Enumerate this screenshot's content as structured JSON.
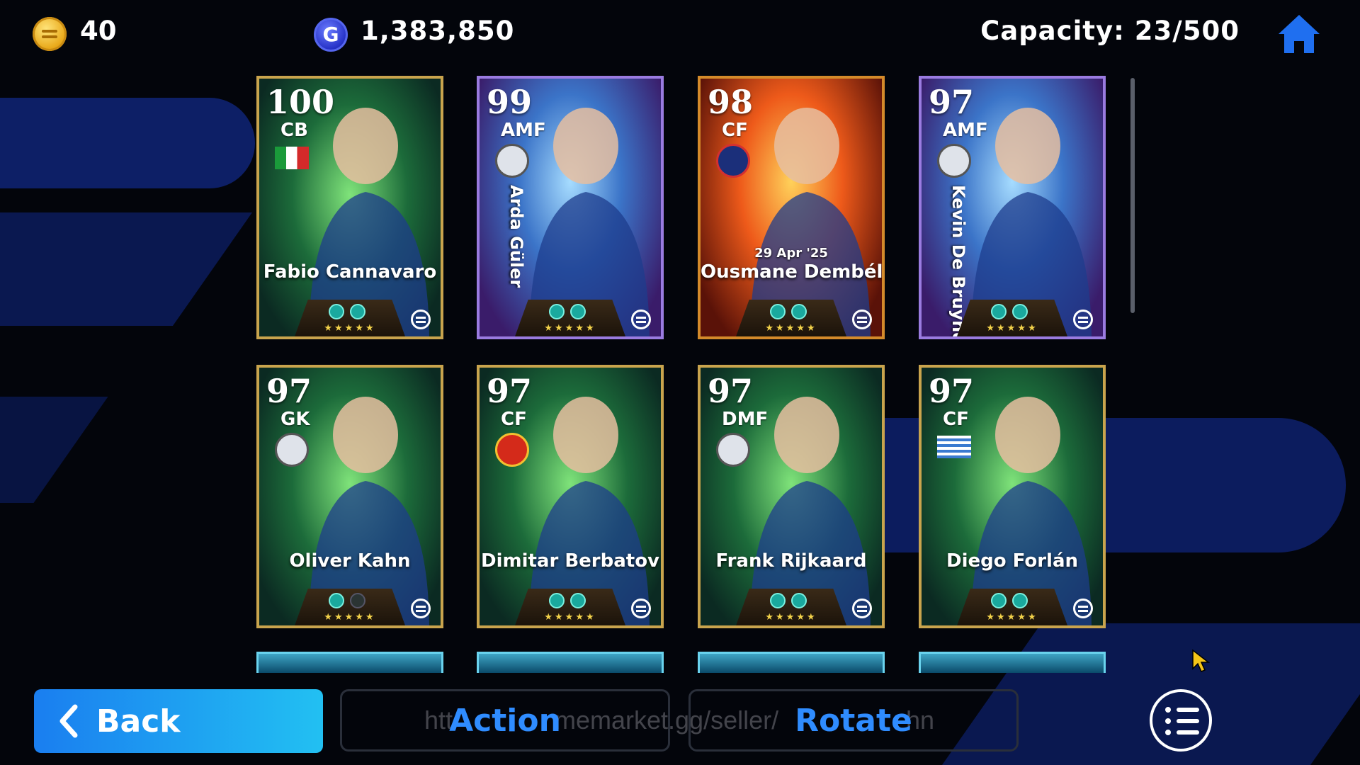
{
  "header": {
    "coins": "40",
    "gp": "1,383,850",
    "gp_icon_letter": "G",
    "capacity": "Capacity: 23/500",
    "coin_icon": "ecoin-icon",
    "home_icon": "home-icon"
  },
  "cards": [
    {
      "rating": "100",
      "position": "CB",
      "name": "Fabio Cannavaro",
      "badge": "italy-flag",
      "frame": "gold",
      "bg": "green"
    },
    {
      "rating": "99",
      "position": "AMF",
      "name": "Arda Güler",
      "badge": "club-badge",
      "frame": "purple",
      "bg": "blue",
      "vertical_name": true
    },
    {
      "rating": "98",
      "position": "CF",
      "name": "Ousmane Dembélé",
      "badge": "psg-badge",
      "frame": "orange",
      "bg": "orange",
      "date": "29 Apr '25"
    },
    {
      "rating": "97",
      "position": "AMF",
      "name": "Kevin De Bruyne",
      "badge": "club-badge",
      "frame": "purple",
      "bg": "blue",
      "vertical_name": true
    },
    {
      "rating": "97",
      "position": "GK",
      "name": "Oliver Kahn",
      "badge": "club-badge",
      "frame": "gold",
      "bg": "green"
    },
    {
      "rating": "97",
      "position": "CF",
      "name": "Dimitar Berbatov",
      "badge": "manutd-badge",
      "frame": "gold",
      "bg": "green"
    },
    {
      "rating": "97",
      "position": "DMF",
      "name": "Frank Rijkaard",
      "badge": "club-badge",
      "frame": "gold",
      "bg": "green"
    },
    {
      "rating": "97",
      "position": "CF",
      "name": "Diego Forlán",
      "badge": "uruguay-flag",
      "frame": "gold",
      "bg": "green"
    }
  ],
  "footer": {
    "back_label": "Back",
    "action_label": "Action",
    "rotate_label": "Rotate",
    "watermark_left": "htt",
    "watermark_mid": "memarket.gg/seller/",
    "watermark_right": "hn",
    "menu_icon": "list-menu-icon"
  },
  "colors": {
    "accent": "#2f8cff",
    "back_button": "#1a9ef0",
    "background": "#03050b",
    "frame_gold": "#c9a44d"
  }
}
